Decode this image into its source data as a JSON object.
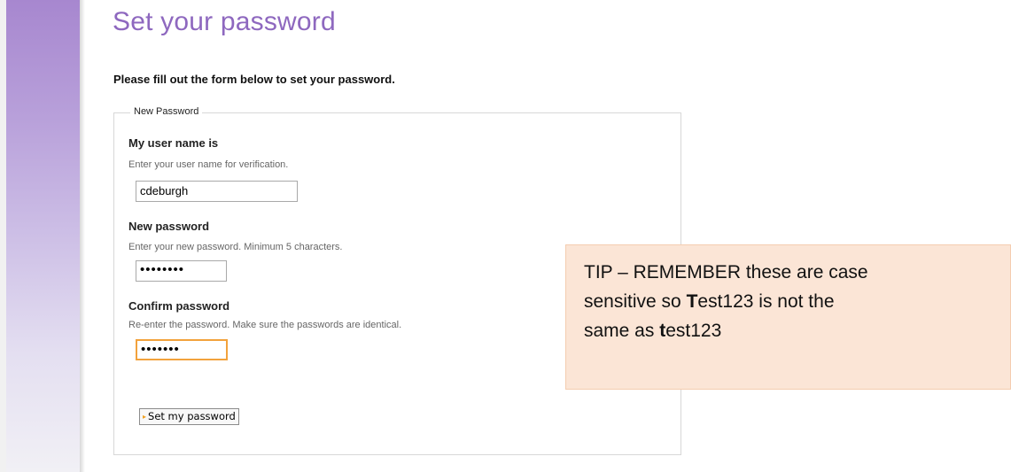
{
  "page": {
    "title": "Set your password",
    "intro": "Please fill out the form below to set your password."
  },
  "form": {
    "legend": "New Password",
    "username": {
      "label": "My user name is",
      "help": "Enter your user name for verification.",
      "value": "cdeburgh"
    },
    "new_password": {
      "label": "New password",
      "help": "Enter your new password. Minimum 5 characters.",
      "masked_value": "••••••••"
    },
    "confirm_password": {
      "label": "Confirm password",
      "help": "Re-enter the password. Make sure the passwords are identical.",
      "masked_value": "•••••••"
    },
    "submit": {
      "label": "Set my password",
      "icon": "arrow-bullet-icon"
    }
  },
  "tip": {
    "line1": "TIP – REMEMBER these are case",
    "line2_pre": "sensitive so ",
    "line2_bold": "T",
    "line2_post": "est123 is not the",
    "line3_pre": "same as ",
    "line3_bold": "t",
    "line3_post": "est123"
  },
  "colors": {
    "title": "#8e68bf",
    "sidebar_top": "#a787cf",
    "focus_border": "#f2a23c",
    "tip_background": "#fbe5d6"
  }
}
